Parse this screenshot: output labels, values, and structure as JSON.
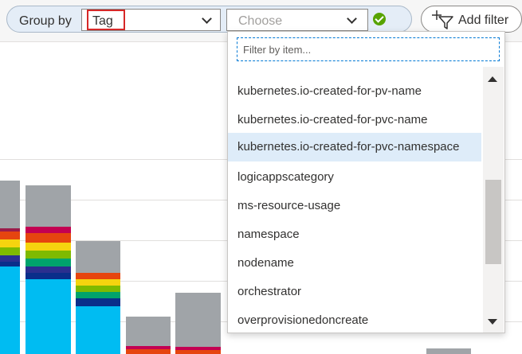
{
  "toolbar": {
    "group_by_label": "Group by",
    "group_by_value": "Tag",
    "choose_placeholder": "Choose",
    "add_filter_label": "Add filter"
  },
  "dropdown": {
    "filter_placeholder": "Filter by item...",
    "items": [
      "kubernetes.io-created-for-pv-name",
      "kubernetes.io-created-for-pvc-name",
      "kubernetes.io-created-for-pvc-namespace",
      "logicappscategory",
      "ms-resource-usage",
      "namespace",
      "nodename",
      "orchestrator",
      "overprovisionedoncreate"
    ],
    "highlighted_index": 2
  },
  "colors": {
    "accent": "#0078d4",
    "success": "#57a300",
    "highlight_box": "#d62828"
  },
  "icons": {
    "add_filter": "filter-plus-icon",
    "confirm": "check-circle-icon",
    "dropdown": "chevron-down-icon"
  }
}
